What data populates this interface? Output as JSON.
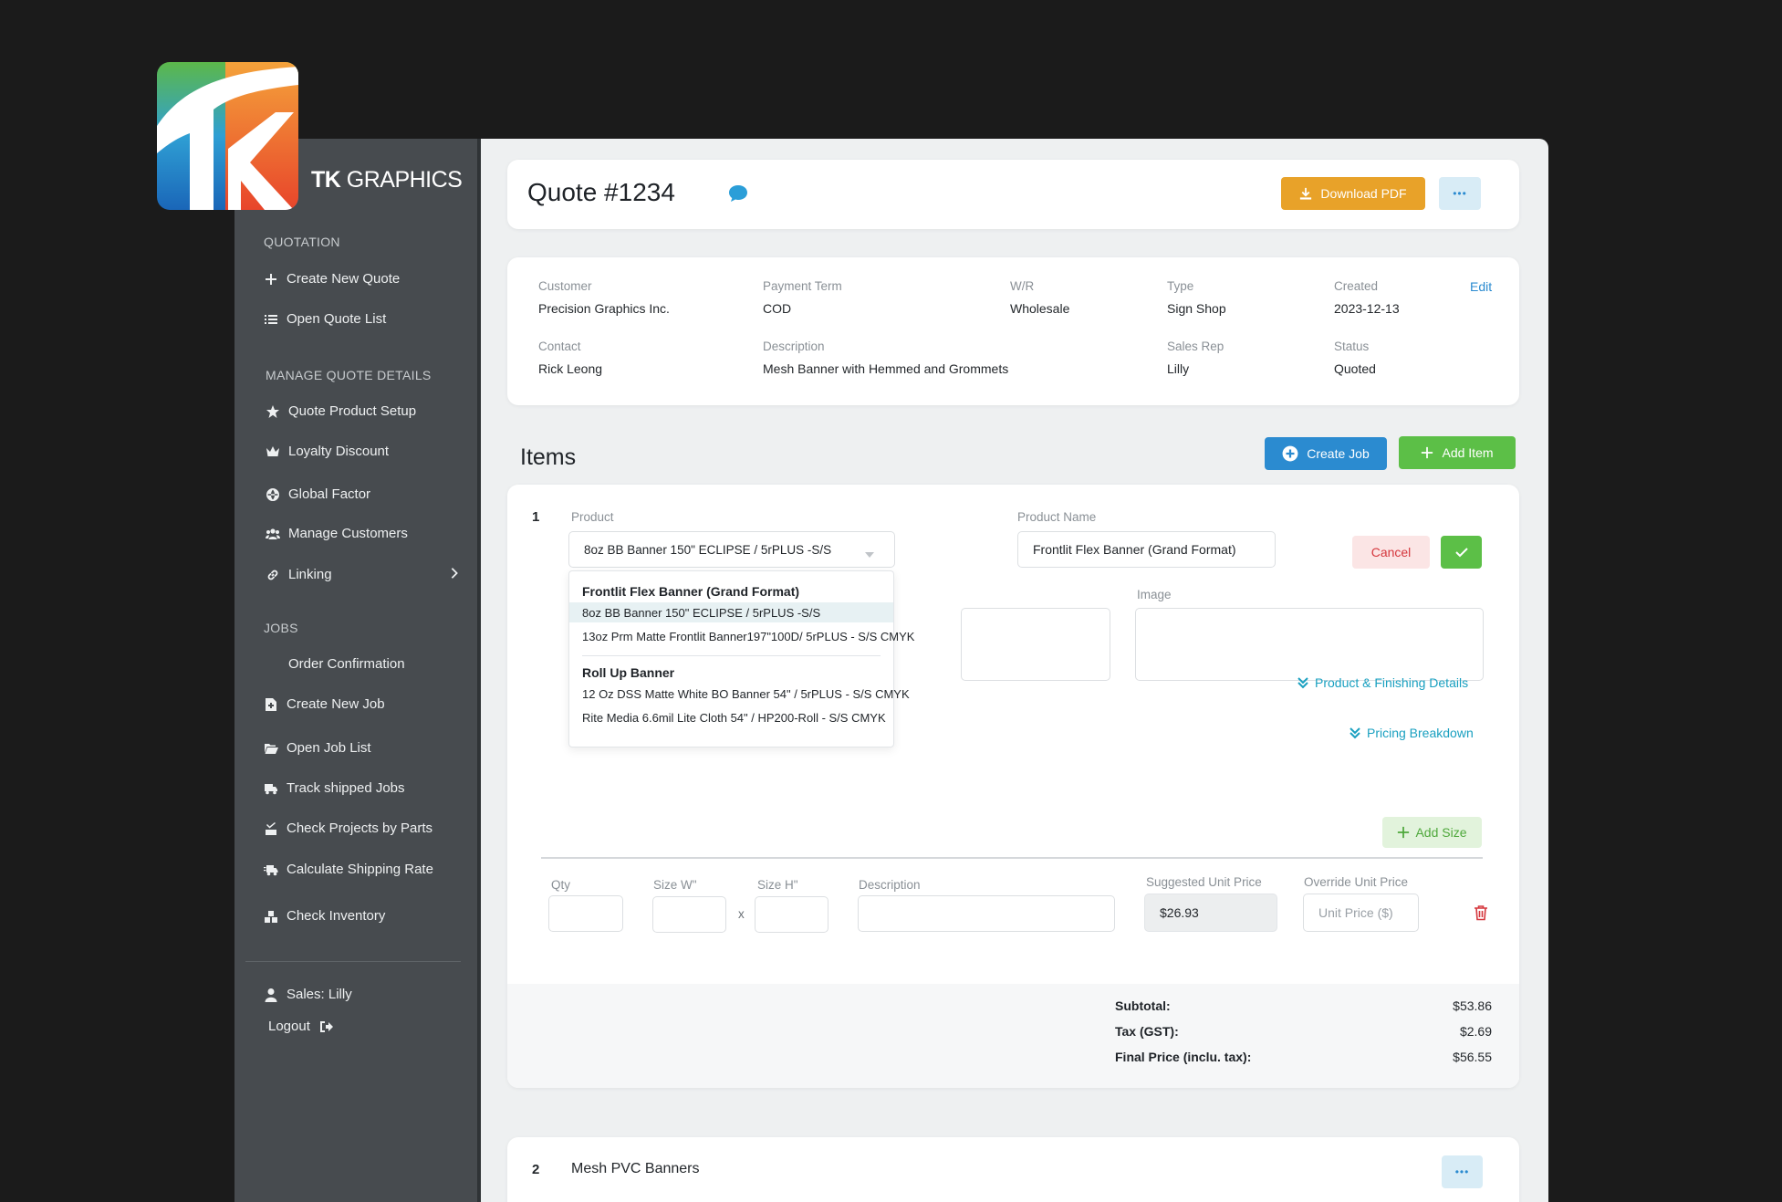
{
  "brand": {
    "name_bold": "TK",
    "name_rest": "GRAPHICS"
  },
  "sidebar": {
    "sections": [
      {
        "title": "QUOTATION"
      },
      {
        "title": "MANAGE QUOTE DETAILS"
      },
      {
        "title": "JOBS"
      }
    ],
    "quotation": [
      {
        "label": "Create New Quote",
        "icon": "plus-icon"
      },
      {
        "label": "Open Quote List",
        "icon": "list-icon"
      }
    ],
    "manage": [
      {
        "label": "Quote Product Setup",
        "icon": "star-icon"
      },
      {
        "label": "Loyalty Discount",
        "icon": "crown-icon"
      },
      {
        "label": "Global Factor",
        "icon": "globe-icon"
      },
      {
        "label": "Manage Customers",
        "icon": "users-icon"
      },
      {
        "label": "Linking",
        "icon": "link-icon"
      }
    ],
    "jobs": [
      {
        "label": "Order Confirmation"
      },
      {
        "label": "Create New Job",
        "icon": "file-plus-icon"
      },
      {
        "label": "Open Job List",
        "icon": "folder-open-icon"
      },
      {
        "label": "Track shipped Jobs",
        "icon": "truck-icon"
      },
      {
        "label": "Check Projects by Parts",
        "icon": "clipboard-check-icon"
      },
      {
        "label": "Calculate Shipping Rate",
        "icon": "truck-fast-icon"
      },
      {
        "label": "Check Inventory",
        "icon": "boxes-icon"
      }
    ],
    "user": "Sales: Lilly",
    "logout": "Logout"
  },
  "header": {
    "title": "Quote #1234",
    "download_label": "Download PDF",
    "more_label": "•••"
  },
  "info": {
    "edit_label": "Edit",
    "customer_label": "Customer",
    "customer": "Precision Graphics Inc.",
    "payment_label": "Payment Term",
    "payment": "COD",
    "wr_label": "W/R",
    "wr": "Wholesale",
    "type_label": "Type",
    "type": "Sign Shop",
    "created_label": "Created",
    "created": "2023-12-13",
    "contact_label": "Contact",
    "contact": "Rick Leong",
    "description_label": "Description",
    "description": "Mesh Banner with Hemmed and Grommets",
    "rep_label": "Sales Rep",
    "rep": "Lilly",
    "status_label": "Status",
    "status": "Quoted"
  },
  "items": {
    "title": "Items",
    "create_job_label": "Create Job",
    "add_item_label": "Add Item"
  },
  "item1": {
    "number": "1",
    "product_label": "Product",
    "product_value": "8oz BB Banner 150\" ECLIPSE / 5rPLUS -S/S",
    "product_name_label": "Product Name",
    "product_name_value": "Frontlit Flex Banner (Grand Format)",
    "cancel_label": "Cancel",
    "image_label": "Image",
    "dropdown": {
      "group1": "Frontlit Flex Banner (Grand Format)",
      "group1_opts": [
        "8oz BB Banner 150\" ECLIPSE / 5rPLUS -S/S",
        "13oz Prm Matte Frontlit Banner197\"100D/ 5rPLUS - S/S CMYK"
      ],
      "group2": "Roll Up Banner",
      "group2_opts": [
        "12 Oz DSS Matte White BO Banner 54\" / 5rPLUS - S/S CMYK",
        "Rite Media 6.6mil Lite Cloth 54\" / HP200-Roll - S/S CMYK"
      ]
    },
    "finishing_label": "Product & Finishing Details",
    "pricing_label": "Pricing Breakdown",
    "add_size_label": "Add Size",
    "qty_label": "Qty",
    "size_w_label": "Size W\"",
    "size_h_label": "Size H\"",
    "times": "x",
    "desc_label": "Description",
    "suggested_label": "Suggested Unit Price",
    "suggested_value": "$26.93",
    "override_label": "Override Unit Price",
    "override_placeholder": "Unit Price ($)",
    "subtotal_label": "Subtotal:",
    "subtotal": "$53.86",
    "tax_label": "Tax (GST):",
    "tax": "$2.69",
    "final_label": "Final Price (inclu. tax):",
    "final": "$56.55"
  },
  "item2": {
    "number": "2",
    "title": "Mesh PVC Banners",
    "more_label": "•••"
  },
  "colors": {
    "orange": "#e8a229",
    "blue": "#2b8bd0",
    "green": "#5cbf47",
    "teal": "#1aa0c0",
    "sidebar": "#474b4f"
  }
}
